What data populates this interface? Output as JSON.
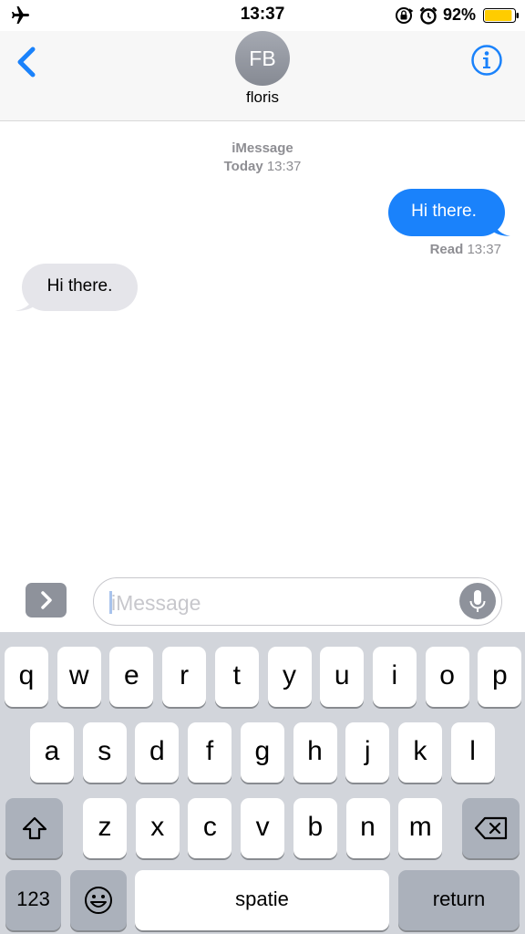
{
  "status_bar": {
    "time": "13:37",
    "battery_percent": "92%",
    "battery_level": 0.92,
    "battery_color": "#ffcc00",
    "icons": [
      "airplane-icon",
      "orientation-lock-icon",
      "alarm-icon",
      "battery-icon"
    ]
  },
  "header": {
    "avatar_initials": "FB",
    "contact_name": "floris",
    "back_icon": "chevron-left-icon",
    "info_icon": "info-icon",
    "accent_color": "#1a82fb"
  },
  "conversation": {
    "service": "iMessage",
    "timestamp_day": "Today",
    "timestamp_time": "13:37",
    "messages": [
      {
        "direction": "outgoing",
        "text": "Hi there.",
        "bubble_color": "#1a82fb"
      },
      {
        "direction": "incoming",
        "text": "Hi there.",
        "bubble_color": "#e5e5ea"
      }
    ],
    "read_status": "Read",
    "read_time": "13:37"
  },
  "input_bar": {
    "placeholder": "iMessage",
    "apps_icon": "chevron-right-icon",
    "mic_icon": "microphone-icon"
  },
  "keyboard": {
    "row1": [
      "q",
      "w",
      "e",
      "r",
      "t",
      "y",
      "u",
      "i",
      "o",
      "p"
    ],
    "row2": [
      "a",
      "s",
      "d",
      "f",
      "g",
      "h",
      "j",
      "k",
      "l"
    ],
    "row3": [
      "z",
      "x",
      "c",
      "v",
      "b",
      "n",
      "m"
    ],
    "shift_icon": "shift-icon",
    "delete_icon": "backspace-icon",
    "numbers_label": "123",
    "emoji_icon": "emoji-icon",
    "space_label": "spatie",
    "return_label": "return"
  }
}
